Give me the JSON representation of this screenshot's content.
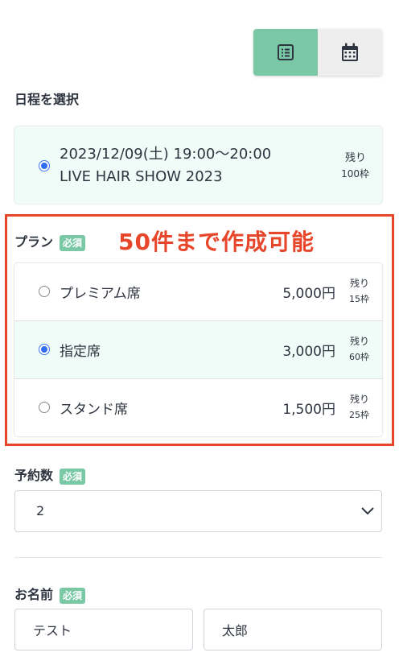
{
  "view_toggle": {
    "active": "list-view",
    "icons": [
      "list-icon",
      "calendar-icon"
    ]
  },
  "schedule": {
    "label": "日程を選択",
    "option": {
      "date_line": "2023/12/09(土) 19:00〜20:00",
      "event_name": "LIVE HAIR SHOW 2023",
      "remaining_label": "残り",
      "remaining_count": "100枠",
      "selected": true
    }
  },
  "plan": {
    "label": "プラン",
    "badge": "必須",
    "annotation": "50件まで作成可能",
    "options": [
      {
        "name": "プレミアム席",
        "price": "5,000円",
        "remaining_label": "残り",
        "remaining_count": "15枠",
        "selected": false
      },
      {
        "name": "指定席",
        "price": "3,000円",
        "remaining_label": "残り",
        "remaining_count": "60枠",
        "selected": true
      },
      {
        "name": "スタンド席",
        "price": "1,500円",
        "remaining_label": "残り",
        "remaining_count": "25枠",
        "selected": false
      }
    ]
  },
  "reservation_count": {
    "label": "予約数",
    "badge": "必須",
    "value": "2"
  },
  "name": {
    "label": "お名前",
    "badge": "必須",
    "last_name": "テスト",
    "first_name": "太郎"
  },
  "colors": {
    "accent": "#7ac8a6",
    "selected_bg": "#f0fcf7",
    "radio": "#2f6ef0",
    "annotation": "#e8462a"
  }
}
